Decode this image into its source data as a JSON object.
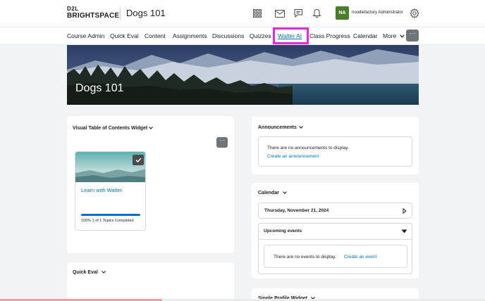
{
  "header": {
    "brand_top": "D2L",
    "brand_bottom": "BRIGHTSPACE",
    "course_title": "Dogs 101",
    "icons": [
      "app-grid-icon",
      "mail-icon",
      "chat-icon",
      "bell-icon",
      "gear-icon"
    ],
    "avatar_initials": "NA",
    "user_name": "noodlefactory Administrator"
  },
  "nav": {
    "items": [
      "Course Admin",
      "Quick Eval",
      "Content",
      "Assignments",
      "Discussions",
      "Quizzes",
      "Walter AI",
      "Class Progress",
      "Calendar",
      "More"
    ],
    "active": "Walter AI",
    "more_dots": "···"
  },
  "banner": {
    "title": "Dogs 101"
  },
  "visual_toc": {
    "title": "Visual Table of Contents Widget",
    "menu_dots": "···",
    "card": {
      "title": "Learn with Walter",
      "progress_fraction": 1.0,
      "progress_text": "100%   1 of 1 Topics Completed"
    }
  },
  "quick_eval": {
    "title": "Quick Eval"
  },
  "announcements": {
    "title": "Announcements",
    "empty_text": "There are no announcements to display.",
    "create_link": "Create an announcement"
  },
  "calendar": {
    "title": "Calendar",
    "date": "Thursday, November 21, 2024",
    "upcoming_title": "Upcoming events",
    "empty_text": "There are no events to display.",
    "create_link": "Create an event"
  },
  "single_profile": {
    "title": "Single Profile Widget"
  },
  "colors": {
    "accent": "#006fbf",
    "avatar": "#4c7d2d",
    "highlight": "#e529d8"
  }
}
